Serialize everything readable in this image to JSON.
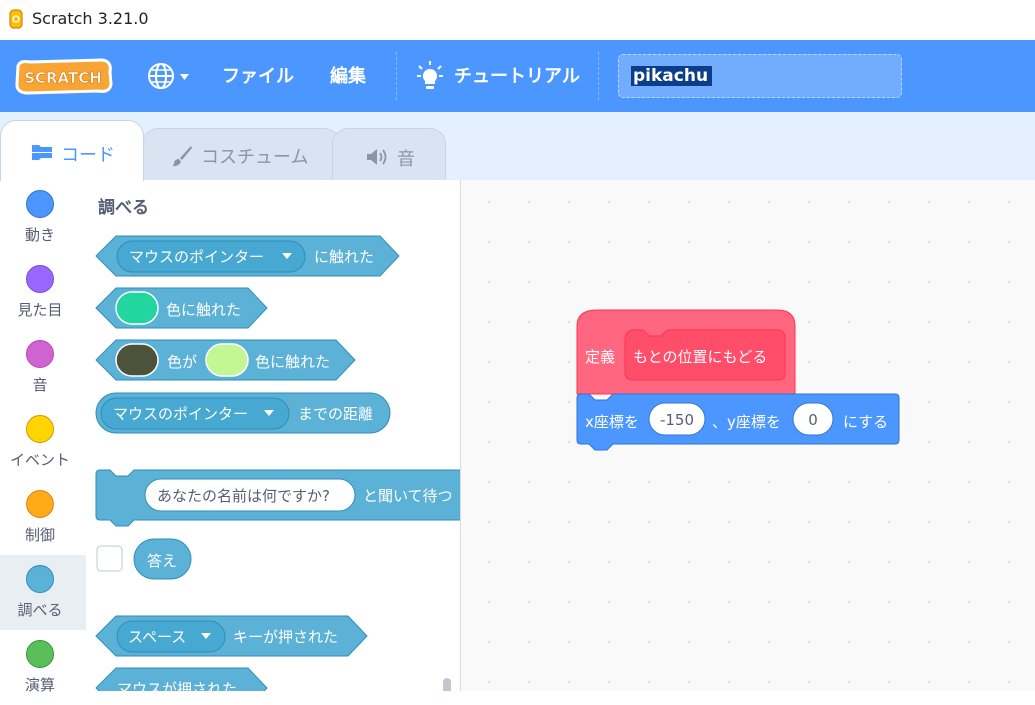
{
  "window": {
    "title": "Scratch 3.21.0"
  },
  "menubar": {
    "logo_text": "SCRATCH",
    "file": "ファイル",
    "edit": "編集",
    "tutorials": "チュートリアル",
    "project_title": "pikachu"
  },
  "tabs": [
    {
      "label": "コード",
      "icon": "code-icon",
      "active": true
    },
    {
      "label": "コスチューム",
      "icon": "brush-icon",
      "active": false
    },
    {
      "label": "音",
      "icon": "speaker-icon",
      "active": false
    }
  ],
  "categories": [
    {
      "label": "動き",
      "color": "#4c97ff",
      "border": "#3373cc"
    },
    {
      "label": "見た目",
      "color": "#9966ff",
      "border": "#774dcb"
    },
    {
      "label": "音",
      "color": "#cf63cf",
      "border": "#bd42bd"
    },
    {
      "label": "イベント",
      "color": "#ffd500",
      "border": "#cc9900"
    },
    {
      "label": "制御",
      "color": "#ffab19",
      "border": "#cf8b17"
    },
    {
      "label": "調べる",
      "color": "#5cb1d6",
      "border": "#2e8eb8",
      "selected": true
    },
    {
      "label": "演算",
      "color": "#59c059",
      "border": "#389438"
    }
  ],
  "palette": {
    "heading": "調べる",
    "touching": {
      "menu": "マウスのポインター",
      "label": "に触れた"
    },
    "touching_color": {
      "label": "色に触れた",
      "color": "#22d6a0"
    },
    "color_touching_color": {
      "label1": "色が",
      "label2": "色に触れた",
      "color1": "#4b543a",
      "color2": "#c2f794"
    },
    "distance": {
      "menu": "マウスのポインター",
      "label": "までの距離"
    },
    "ask": {
      "question": "あなたの名前は何ですか?",
      "label": "と聞いて待つ"
    },
    "answer": {
      "label": "答え"
    },
    "key_pressed": {
      "menu": "スペース",
      "label": "キーが押された"
    },
    "mouse_down": {
      "label": "マウスが押された"
    }
  },
  "workspace": {
    "define": {
      "label": "定義",
      "name": "もとの位置にもどる"
    },
    "goto": {
      "label1": "x座標を",
      "x": "-150",
      "label2": "、y座標を",
      "y": "0",
      "label3": "にする"
    }
  },
  "colors": {
    "menubar": "#4c97ff",
    "sensing": "#5cb1d6",
    "sensing_dark": "#2e8eb8",
    "motion": "#4c97ff",
    "custom": "#ff6680"
  }
}
